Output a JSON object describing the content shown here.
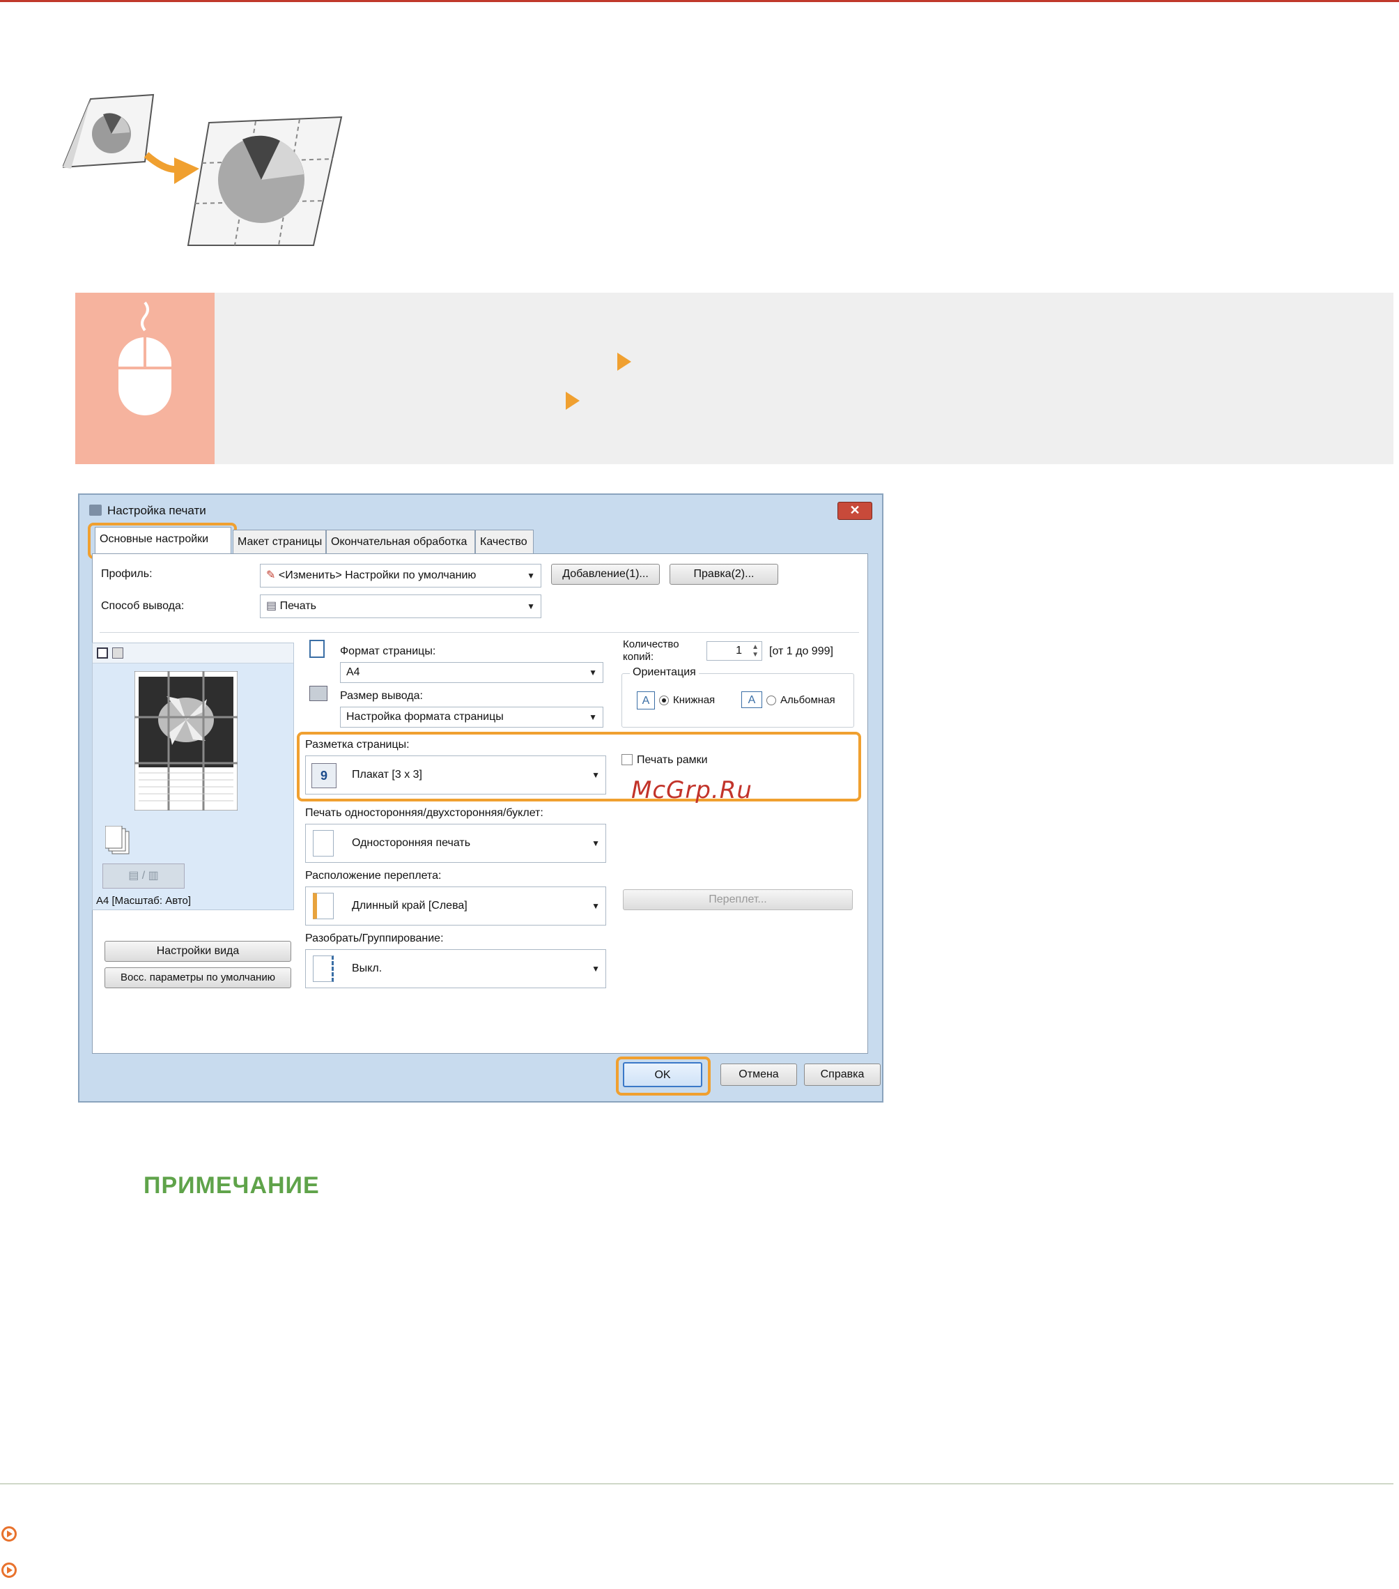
{
  "window": {
    "title": "Настройка печати",
    "close_glyph": "✕"
  },
  "tabs": [
    {
      "label": "Основные настройки"
    },
    {
      "label": "Макет страницы"
    },
    {
      "label": "Окончательная обработка"
    },
    {
      "label": "Качество"
    }
  ],
  "profile": {
    "label": "Профиль:",
    "value": "<Изменить> Настройки по умолчанию",
    "add_button": "Добавление(1)...",
    "edit_button": "Правка(2)..."
  },
  "output_method": {
    "label": "Способ вывода:",
    "value": "Печать"
  },
  "preview": {
    "caption": "A4 [Масштаб: Авто]",
    "view_settings_button": "Настройки вида",
    "restore_defaults_button": "Восс. параметры по умолчанию"
  },
  "page_size": {
    "label": "Формат страницы:",
    "value": "A4"
  },
  "output_size": {
    "label": "Размер вывода:",
    "value": "Настройка формата страницы"
  },
  "copies": {
    "label": "Количество копий:",
    "value": "1",
    "range": "[от 1 до 999]"
  },
  "orientation": {
    "label": "Ориентация",
    "portrait": "Книжная",
    "landscape": "Альбомная",
    "icon_letter": "A"
  },
  "page_layout": {
    "label": "Разметка страницы:",
    "value": "Плакат [3 x 3]",
    "icon_number": "9"
  },
  "print_border": {
    "label": "Печать рамки",
    "checked": false
  },
  "duplex": {
    "label": "Печать односторонняя/двухсторонняя/буклет:",
    "value": "Односторонняя печать"
  },
  "binding": {
    "label": "Расположение переплета:",
    "value": "Длинный край [Слева]",
    "button": "Переплет..."
  },
  "collate": {
    "label": "Разобрать/Группирование:",
    "value": "Выкл."
  },
  "footer_buttons": {
    "ok": "OK",
    "cancel": "Отмена",
    "help": "Справка"
  },
  "watermark": "McGrp.Ru",
  "note_heading": "ПРИМЕЧАНИЕ",
  "colors": {
    "accent_orange": "#f0a030",
    "note_green": "#5fa34a",
    "rule_red": "#c0392b",
    "banner_salmon": "#f6b39e"
  }
}
